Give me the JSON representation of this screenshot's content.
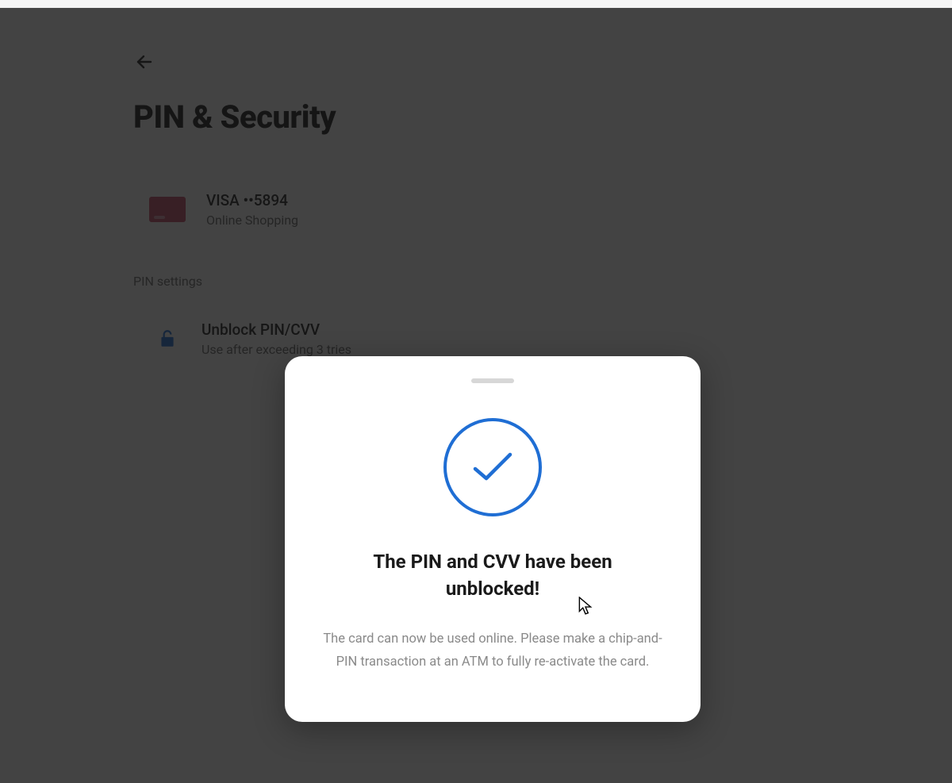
{
  "header": {
    "page_title": "PIN & Security"
  },
  "card": {
    "title": "VISA ••5894",
    "subtitle": "Online Shopping"
  },
  "section_label": "PIN settings",
  "unblock_row": {
    "title": "Unblock PIN/CVV",
    "subtitle": "Use after exceeding 3 tries"
  },
  "modal": {
    "title": "The PIN and CVV have been unblocked!",
    "description": "The card can now be used online. Please make a chip-and-PIN transaction at an ATM to fully re-activate the card."
  }
}
